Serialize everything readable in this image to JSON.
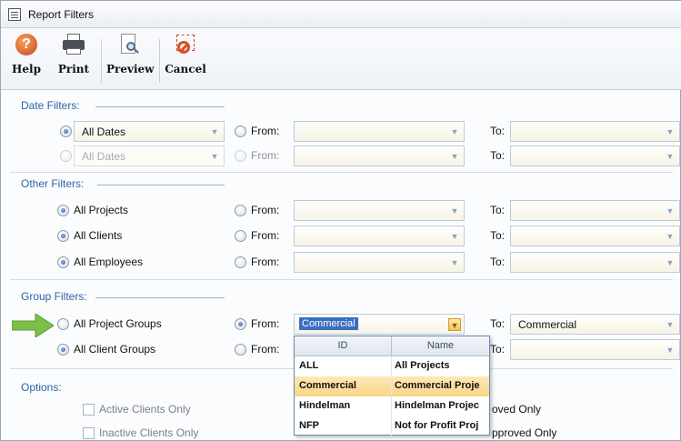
{
  "window": {
    "title": "Report Filters"
  },
  "toolbar": {
    "help": "Help",
    "print": "Print",
    "preview": "Preview",
    "cancel": "Cancel"
  },
  "sections": {
    "date": "Date Filters:",
    "other": "Other Filters:",
    "group": "Group Filters:",
    "options": "Options:"
  },
  "date_rows": [
    {
      "combo": "All Dates",
      "from": "From:",
      "to": "To:"
    },
    {
      "combo": "All Dates",
      "from": "From:",
      "to": "To:"
    }
  ],
  "other_rows": [
    {
      "label": "All Projects",
      "from": "From:",
      "to": "To:"
    },
    {
      "label": "All Clients",
      "from": "From:",
      "to": "To:"
    },
    {
      "label": "All Employees",
      "from": "From:",
      "to": "To:"
    }
  ],
  "group_rows": [
    {
      "label": "All Project Groups",
      "from": "From:",
      "from_value": "Commercial",
      "to": "To:",
      "to_value": "Commercial"
    },
    {
      "label": "All Client Groups",
      "from": "From:",
      "to": "To:"
    }
  ],
  "dropdown": {
    "col_id": "ID",
    "col_name": "Name",
    "rows": [
      {
        "id": "ALL",
        "name": "All Projects"
      },
      {
        "id": "Commercial",
        "name": "Commercial Proje"
      },
      {
        "id": "Hindelman",
        "name": "Hindelman Projec"
      },
      {
        "id": "NFP",
        "name": "Not for Profit Proj"
      }
    ]
  },
  "options": {
    "active_clients": "Active Clients Only",
    "inactive_clients": "Inactive Clients Only",
    "approved_partial_1": "oved Only",
    "approved_partial_2": "pproved Only"
  },
  "colors": {
    "accent": "#2f64a8",
    "highlight": "#f9d685",
    "arrow": "#7cc04a"
  }
}
